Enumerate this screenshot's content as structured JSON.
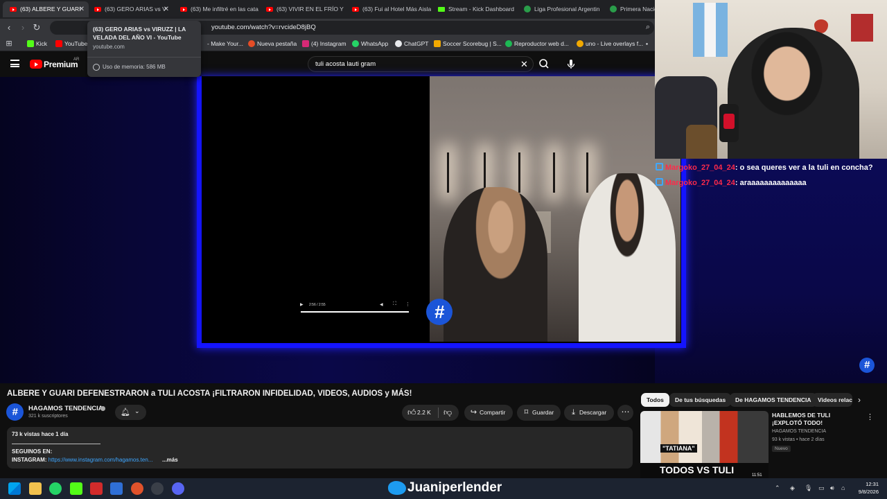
{
  "browser": {
    "tabs": [
      {
        "label": "(63) ALBERE Y GUARI",
        "icon": "youtube"
      },
      {
        "label": "(63) GERO ARIAS vs V",
        "icon": "youtube"
      },
      {
        "label": "(63) Me infiltré en las cata",
        "icon": "youtube"
      },
      {
        "label": "(63) VIVIR EN EL FRÍO Y E",
        "icon": "youtube"
      },
      {
        "label": "(63) Fui al Hotel Más Aisla",
        "icon": "youtube"
      },
      {
        "label": "Stream - Kick Dashboard",
        "icon": "kick"
      },
      {
        "label": "Liga Profesional Argentin",
        "icon": "ball"
      },
      {
        "label": "Primera Nacio",
        "icon": "ball"
      }
    ],
    "url": "youtube.com/watch?v=rvcideD8jBQ",
    "bookmarks": [
      {
        "label": "Kick",
        "color": "#53fc18"
      },
      {
        "label": "YouTube",
        "color": "#ff0000"
      },
      {
        "label": "- Make Your...",
        "color": "#35363a"
      },
      {
        "label": "Nueva pestaña",
        "color": "#e54d26"
      },
      {
        "label": "(4) Instagram",
        "color": "#d62976"
      },
      {
        "label": "WhatsApp",
        "color": "#25d366"
      },
      {
        "label": "ChatGPT",
        "color": "#e8eaed"
      },
      {
        "label": "Soccer Scorebug | S...",
        "color": "#f2a900"
      },
      {
        "label": "Reproductor web d...",
        "color": "#1db954"
      },
      {
        "label": "uno - Live overlays f...",
        "color": "#f2a900"
      }
    ],
    "hover_card": {
      "title": "(63) GERO ARIAS vs VIRUZZ | LA VELADA DEL AÑO VI - YouTube",
      "domain": "youtube.com",
      "memory": "Uso de memoria: 586 MB"
    }
  },
  "youtube": {
    "logo_text": "Premium",
    "country": "AR",
    "search_query": "tuli acosta lauti gram",
    "player": {
      "time": "2:56 / 2:55"
    },
    "video_title": "ALBERE Y GUARI DEFENESTRARON a TULI ACOSTA ¡FILTRARON INFIDELIDAD, VIDEOS, AUDIOS y MÁS!",
    "channel": {
      "name": "HAGAMOS TENDENCIA",
      "subscribers": "321 k suscriptores"
    },
    "actions": {
      "likes": "2.2 K",
      "share": "Compartir",
      "save": "Guardar",
      "download": "Descargar"
    },
    "description": {
      "meta": "73 k vistas  hace 1 día",
      "line1": "SEGUINOS EN:",
      "instagram_label": "INSTAGRAM: ",
      "instagram_link": "https://www.instagram.com/hagamos.ten...",
      "more": "...más"
    },
    "chips": [
      "Todos",
      "De tus búsquedas",
      "De HAGAMOS TENDENCIA",
      "Videos relac"
    ],
    "recommendation": {
      "title": "HABLEMOS DE TULI ¡EXPLOTÓ TODO!",
      "channel": "HAGAMOS TENDENCIA",
      "meta": "93 k vistas • hace 2 días",
      "badge": "Nuevo",
      "thumb_text": "TODOS VS TULI",
      "thumb_tag": "\"TATIANA\"",
      "duration": "11:51"
    }
  },
  "stream_overlay": {
    "chat": [
      {
        "user": "Margoko_27_04_24",
        "message": ": o sea queres ver a la tuli en concha?"
      },
      {
        "user": "Margoko_27_04_24",
        "message": ": araaaaaaaaaaaaaa"
      }
    ],
    "twitter_handle": "Juaniperlender",
    "watermark": "#"
  },
  "taskbar": {
    "time": "12:31",
    "date": "9/8/2026"
  },
  "colors": {
    "accent_blue": "#1414ff",
    "youtube_red": "#ff0000",
    "chat_name": "#ff2a4a",
    "link": "#3ea6ff"
  }
}
